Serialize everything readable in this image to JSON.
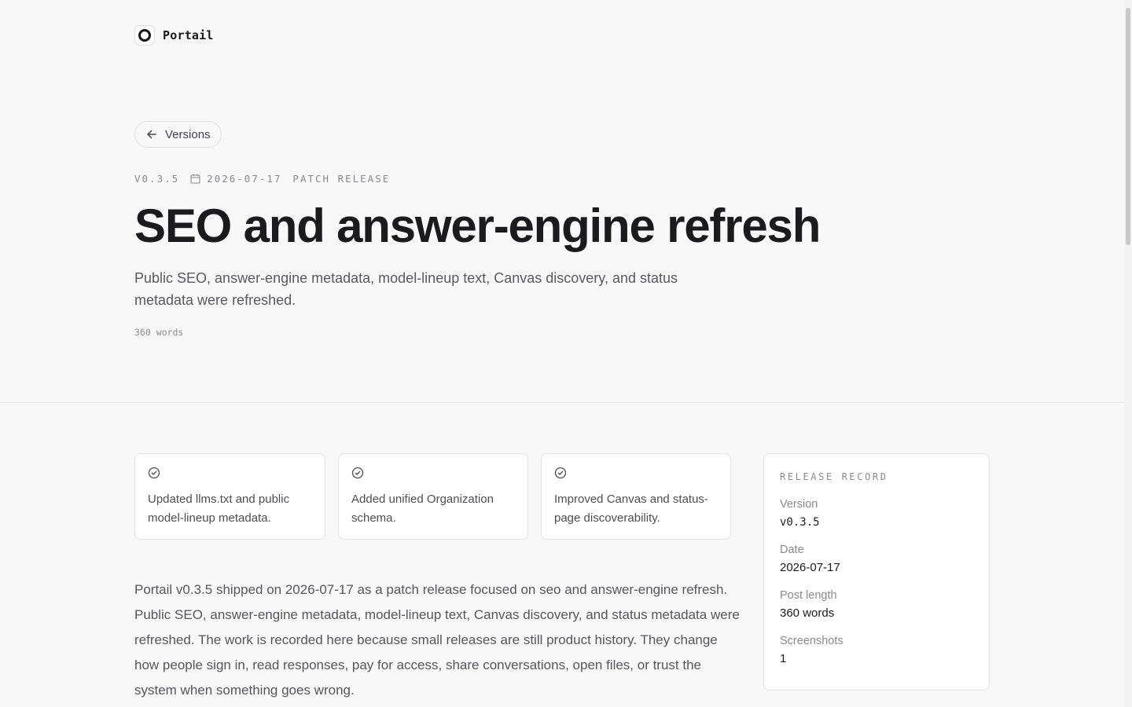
{
  "brand": {
    "name": "Portail",
    "icon": "portail-logo-icon"
  },
  "nav": {
    "back_label": "Versions",
    "back_icon": "arrow-left-icon"
  },
  "release": {
    "version": "V0.3.5",
    "date": "2026-07-17",
    "date_icon": "calendar-icon",
    "type": "PATCH RELEASE",
    "title": "SEO and answer-engine refresh",
    "summary": "Public SEO, answer-engine metadata, model-lineup text, Canvas discovery, and status metadata were refreshed.",
    "word_count": "360 words"
  },
  "highlights": [
    {
      "icon": "check-circle-icon",
      "text": "Updated llms.txt and public model-lineup metadata."
    },
    {
      "icon": "check-circle-icon",
      "text": "Added unified Organization schema."
    },
    {
      "icon": "check-circle-icon",
      "text": "Improved Canvas and status-page discoverability."
    }
  ],
  "body": "Portail v0.3.5 shipped on 2026-07-17 as a patch release focused on seo and answer-engine refresh. Public SEO, answer-engine metadata, model-lineup text, Canvas discovery, and status metadata were refreshed. The work is recorded here because small releases are still product history. They change how people sign in, read responses, pay for access, share conversations, open files, or trust the system when something goes wrong.",
  "record": {
    "title": "RELEASE RECORD",
    "items": [
      {
        "label": "Version",
        "value": "v0.3.5"
      },
      {
        "label": "Date",
        "value": "2026-07-17"
      },
      {
        "label": "Post length",
        "value": "360 words"
      },
      {
        "label": "Screenshots",
        "value": "1"
      }
    ]
  },
  "colors": {
    "background": "#f8f8f8",
    "text": "#1b1b1d",
    "muted": "#8a8a8e",
    "border": "#e3e3e5"
  }
}
